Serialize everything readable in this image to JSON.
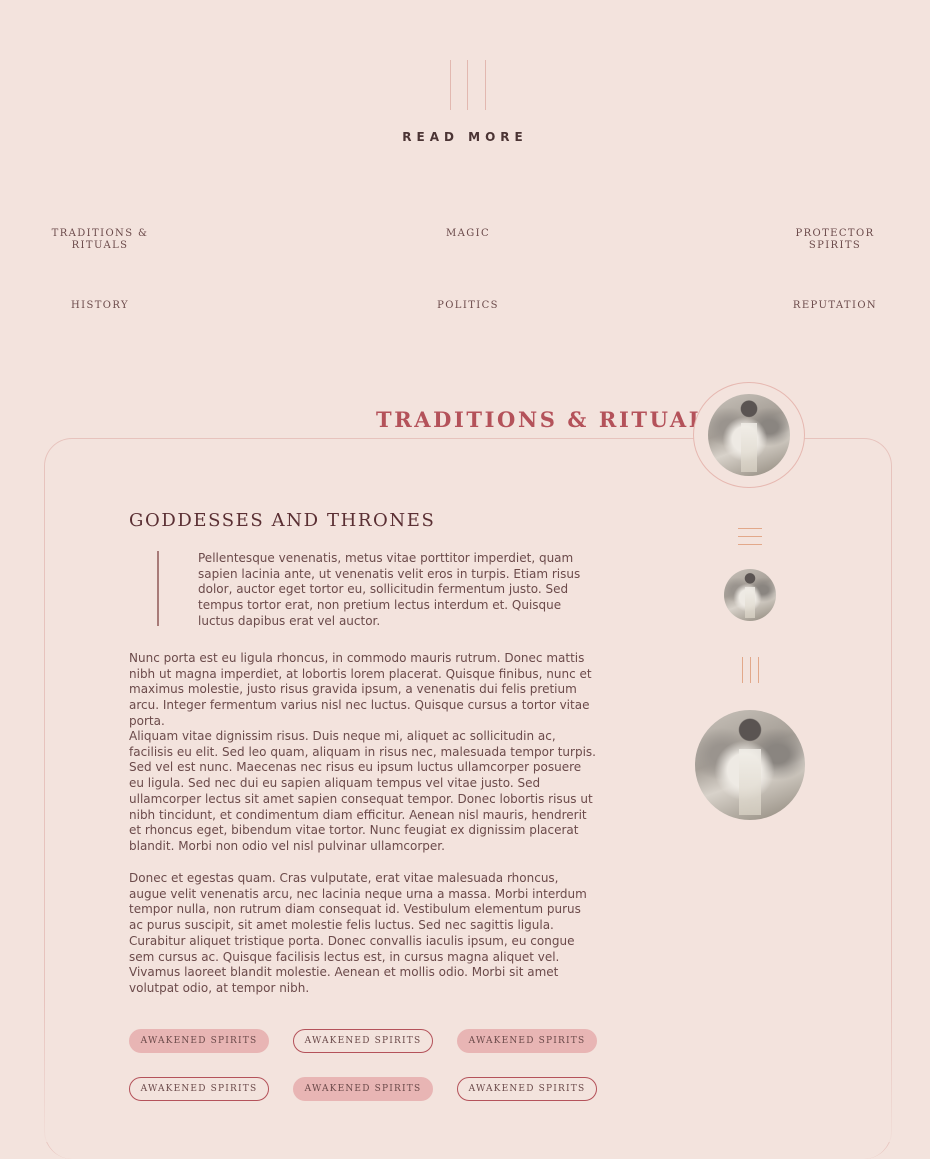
{
  "read_more": "READ MORE",
  "nav": [
    {
      "label": "TRADITIONS & RITUALS"
    },
    {
      "label": "MAGIC"
    },
    {
      "label": "PROTECTOR SPIRITS"
    },
    {
      "label": "HISTORY"
    },
    {
      "label": "POLITICS"
    },
    {
      "label": "REPUTATION"
    }
  ],
  "section": {
    "title": "TRADITIONS & RITUALS"
  },
  "article": {
    "heading": "GODDESSES AND THRONES",
    "quote": "Pellentesque venenatis, metus vitae porttitor imperdiet, quam sapien lacinia ante, ut venenatis velit eros in turpis. Etiam risus dolor, auctor eget tortor eu, sollicitudin fermentum justo. Sed tempus tortor erat, non pretium lectus interdum et. Quisque luctus dapibus erat vel auctor.",
    "paragraphs": [
      "Nunc porta est eu ligula rhoncus, in commodo mauris rutrum. Donec mattis nibh ut magna imperdiet, at lobortis lorem placerat. Quisque finibus, nunc et maximus molestie, justo risus gravida ipsum, a venenatis dui felis pretium arcu. Integer fermentum varius nisl nec luctus. Quisque cursus a tortor vitae porta.",
      "Aliquam vitae dignissim risus. Duis neque mi, aliquet ac sollicitudin ac, facilisis eu elit. Sed leo quam, aliquam in risus nec, malesuada tempor turpis. Sed vel est nunc. Maecenas nec risus eu ipsum luctus ullamcorper posuere eu ligula. Sed nec dui eu sapien aliquam tempus vel vitae justo. Sed ullamcorper lectus sit amet sapien consequat tempor. Donec lobortis risus ut nibh tincidunt, et condimentum diam efficitur. Aenean nisl mauris, hendrerit et rhoncus eget, bibendum vitae tortor. Nunc feugiat ex dignissim placerat blandit. Morbi non odio vel nisl pulvinar ullamcorper.",
      "Donec et egestas quam. Cras vulputate, erat vitae malesuada rhoncus, augue velit venenatis arcu, nec lacinia neque urna a massa. Morbi interdum tempor nulla, non rutrum diam consequat id. Vestibulum elementum purus ac purus suscipit, sit amet molestie felis luctus. Sed nec sagittis ligula. Curabitur aliquet tristique porta. Donec convallis iaculis ipsum, eu congue sem cursus ac. Quisque facilisis lectus est, in cursus magna aliquet vel. Vivamus laoreet blandit molestie. Aenean et mollis odio. Morbi sit amet volutpat odio, at tempor nibh."
    ]
  },
  "tags": [
    {
      "label": "AWAKENED SPIRITS",
      "style": "filled"
    },
    {
      "label": "AWAKENED SPIRITS",
      "style": "outline"
    },
    {
      "label": "AWAKENED SPIRITS",
      "style": "filled"
    },
    {
      "label": "AWAKENED SPIRITS",
      "style": "outline"
    },
    {
      "label": "AWAKENED SPIRITS",
      "style": "filled"
    },
    {
      "label": "AWAKENED SPIRITS",
      "style": "outline"
    }
  ],
  "colors": {
    "background": "#f3e3dd",
    "accent": "#b4525a",
    "heading": "#5a2f33",
    "text": "#6b4a4a",
    "pill_fill": "#e8b5b4",
    "decor_lines": "#e2a88a"
  },
  "images": {
    "section_avatar": "goddess-portrait",
    "sidebar_small": "goddess-portrait",
    "sidebar_large": "goddess-portrait"
  }
}
